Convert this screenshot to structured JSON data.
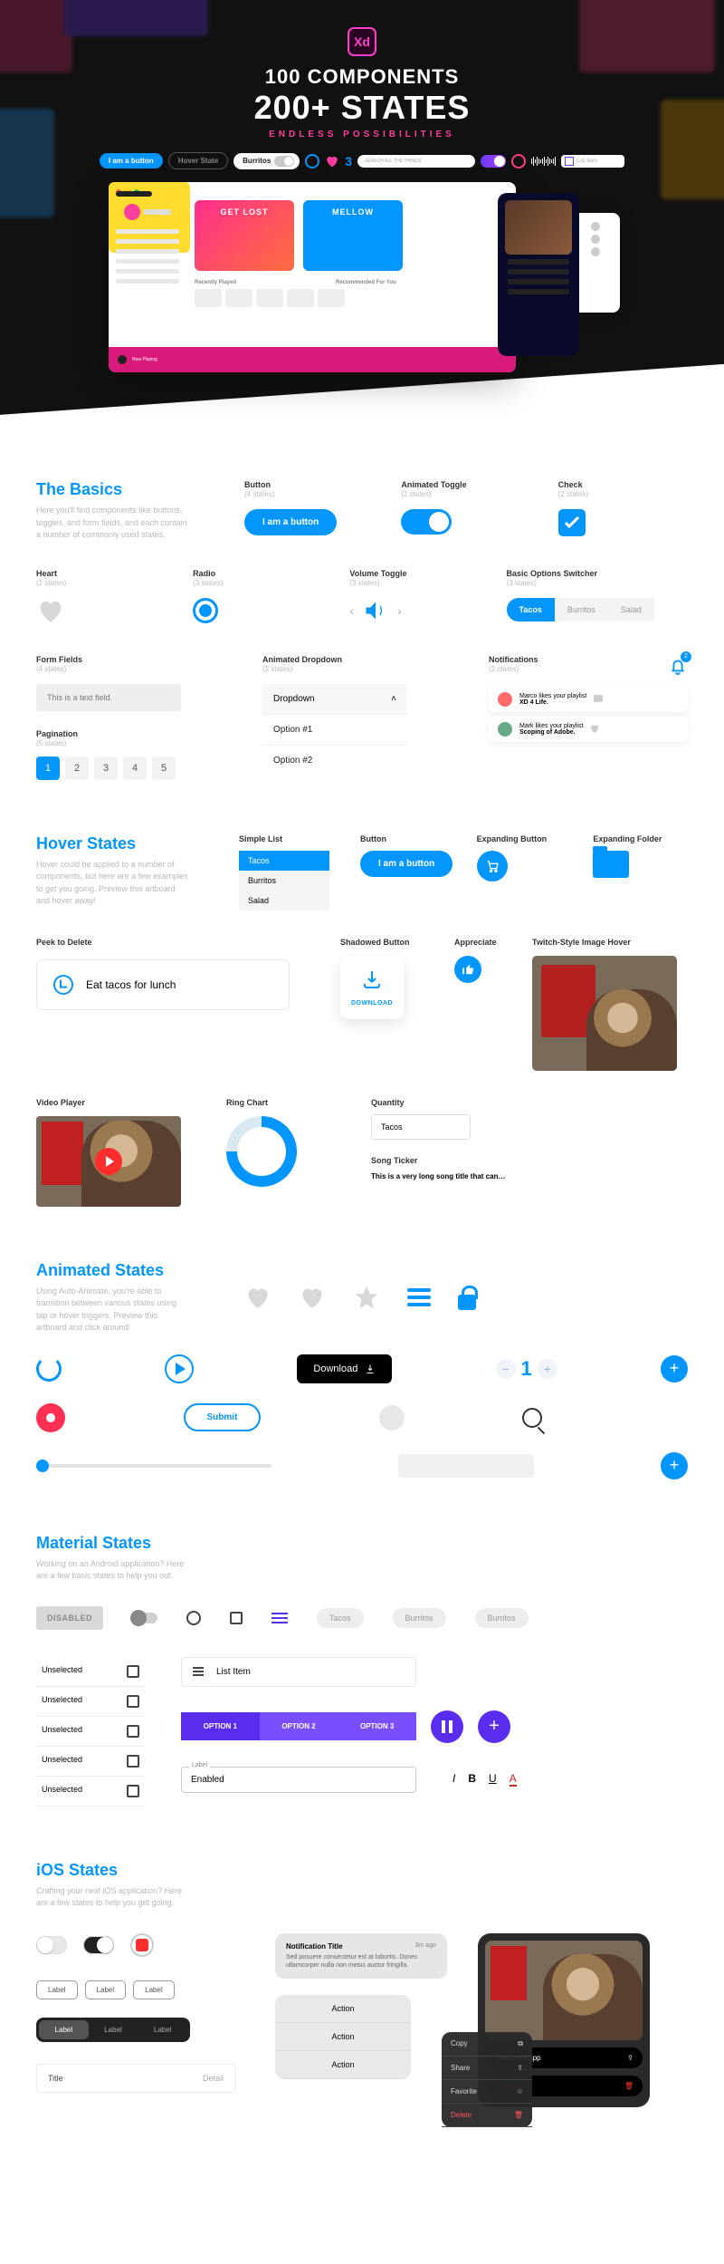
{
  "hero": {
    "app": "Xd",
    "line1": "100 COMPONENTS",
    "line2": "200+ STATES",
    "subtitle": "ENDLESS POSSIBILITIES",
    "pills": {
      "iam": "I am a button",
      "hover": "Hover State",
      "burritos": "Burritos",
      "three": "3",
      "search_placeholder": "SEARCH ALL THE THINGS",
      "listitem": "List Item"
    },
    "mockup": {
      "card1": "GET LOST",
      "card2": "MELLOW",
      "recently": "Recently Played",
      "recommended": "Recommended For You",
      "now_playing": "Now Playing"
    }
  },
  "basics": {
    "title": "The Basics",
    "desc": "Here you'll find components like buttons, toggles, and form fields, and each contain a number of commonly used states.",
    "button": {
      "label": "Button",
      "states": "(4 states)",
      "text": "I am a button"
    },
    "toggle": {
      "label": "Animated Toggle",
      "states": "(2 states)"
    },
    "check": {
      "label": "Check",
      "states": "(2 states)"
    },
    "heart": {
      "label": "Heart",
      "states": "(2 states)"
    },
    "radio": {
      "label": "Radio",
      "states": "(3 states)"
    },
    "volume": {
      "label": "Volume Toggle",
      "states": "(3 states)"
    },
    "switcher": {
      "label": "Basic Options Switcher",
      "states": "(3 states)",
      "tacos": "Tacos",
      "burritos": "Burritos",
      "salad": "Salad"
    },
    "form": {
      "label": "Form Fields",
      "states": "(4 states)",
      "text": "This is a text field."
    },
    "dropdown": {
      "label": "Animated Dropdown",
      "states": "(2 states)",
      "head": "Dropdown",
      "o1": "Option #1",
      "o2": "Option #2"
    },
    "notif": {
      "label": "Notifications",
      "states": "(2 states)",
      "n1_a": "Marco likes your playlist",
      "n1_b": "XD 4 Life.",
      "n2_a": "Mark likes your playlist",
      "n2_b": "Scoping of Adobe.",
      "badge": "2"
    },
    "pagination": {
      "label": "Pagination",
      "states": "(5 states)",
      "p": [
        "1",
        "2",
        "3",
        "4",
        "5"
      ]
    }
  },
  "hover": {
    "title": "Hover States",
    "desc": "Hover could be applied to a number of components, but here are a few examples to get you going. Preview this artboard and hover away!",
    "list": {
      "label": "Simple List",
      "tacos": "Tacos",
      "burritos": "Burritos",
      "salad": "Salad"
    },
    "button": {
      "label": "Button",
      "text": "I am a button"
    },
    "expanding_btn": {
      "label": "Expanding Button"
    },
    "folder": {
      "label": "Expanding Folder"
    },
    "peek": {
      "label": "Peek to Delete",
      "text": "Eat tacos for lunch"
    },
    "shadow": {
      "label": "Shadowed Button",
      "text": "DOWNLOAD"
    },
    "appreciate": {
      "label": "Appreciate"
    },
    "twitch": {
      "label": "Twitch-Style Image Hover"
    },
    "video": {
      "label": "Video Player"
    },
    "ring": {
      "label": "Ring Chart"
    },
    "qty": {
      "label": "Quantity",
      "text": "Tacos"
    },
    "song": {
      "label": "Song Ticker",
      "text": "This is a very long song title that can…"
    }
  },
  "animated": {
    "title": "Animated States",
    "desc": "Using Auto-Animate, you're able to transition between various states using tap or hover triggers. Preview this artboard and click around!",
    "download": "Download",
    "stepper_num": "1",
    "submit": "Submit"
  },
  "material": {
    "title": "Material States",
    "desc": "Working on an Android application? Here are a few basic states to help you out.",
    "disabled": "DISABLED",
    "chips": [
      "Tacos",
      "Burritos",
      "Burritos"
    ],
    "unselected": "Unselected",
    "listitem": "List Item",
    "tabs": [
      "OPTION 1",
      "OPTION 2",
      "OPTION 3"
    ],
    "input": {
      "label": "Label",
      "value": "Enabled"
    },
    "fmt": {
      "i": "I",
      "b": "B",
      "u": "U",
      "a": "A"
    }
  },
  "ios": {
    "title": "iOS States",
    "desc": "Crafting your next iOS application? Here are a few states to help you get going.",
    "label": "Label",
    "filled": {
      "title": "Title",
      "detail": "Detail"
    },
    "notif": {
      "title": "Notification Title",
      "ago": "3m ago",
      "body": "Sed posuere consectetur est at lobortis. Donec ullamcorper nulla non metus auctor fringilla."
    },
    "action": "Action",
    "menu": [
      "Copy",
      "Share",
      "Favorite",
      "Delete"
    ],
    "card": {
      "share": "Share this app",
      "delete": "Delete app"
    }
  }
}
